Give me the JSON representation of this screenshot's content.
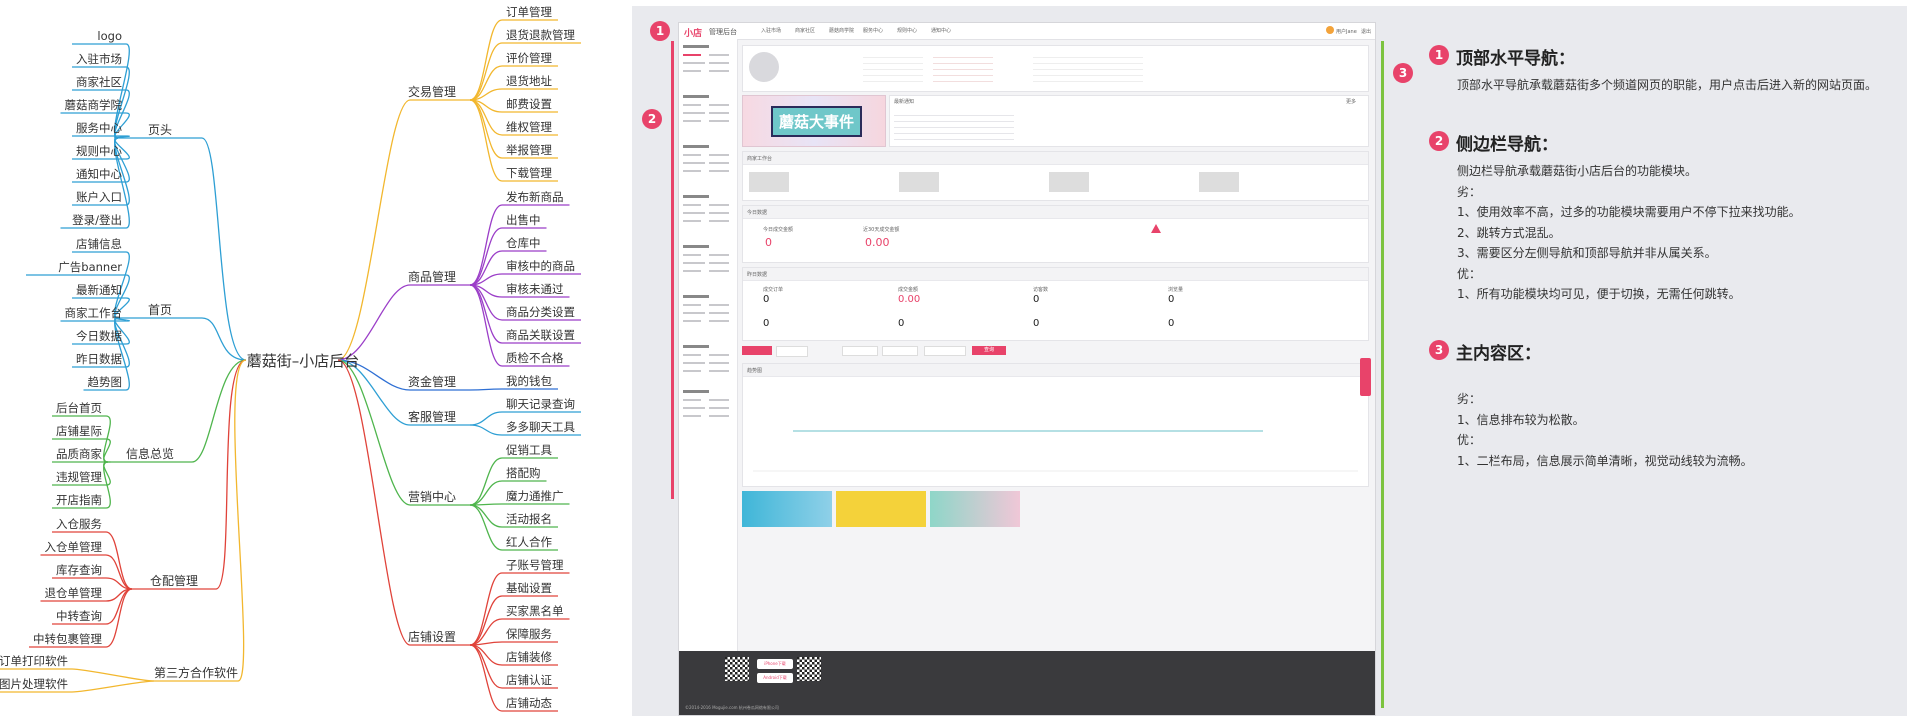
{
  "mindmap": {
    "root": "蘑菇街–小店后台",
    "left_branches": [
      {
        "label": "页头",
        "color": "#2e9fd4",
        "children": [
          "logo",
          "入驻市场",
          "商家社区",
          "蘑菇商学院",
          "服务中心",
          "规则中心",
          "通知中心",
          "账户入口",
          "登录/登出"
        ]
      },
      {
        "label": "首页",
        "color": "#2e9fd4",
        "children": [
          "店铺信息",
          "广告banner",
          "最新通知",
          "商家工作台",
          "今日数据",
          "昨日数据",
          "趋势图"
        ]
      },
      {
        "label": "信息总览",
        "color": "#4fb54d",
        "children": [
          "后台首页",
          "店铺星际",
          "品质商家",
          "违规管理",
          "开店指南"
        ]
      },
      {
        "label": "仓配管理",
        "color": "#e0433a",
        "children": [
          "入仓服务",
          "入仓单管理",
          "库存查询",
          "退仓单管理",
          "中转查询",
          "中转包裹管理"
        ]
      },
      {
        "label": "第三方合作软件",
        "color": "#f2b72e",
        "children": [
          "订单打印软件",
          "图片处理软件"
        ]
      }
    ],
    "right_branches": [
      {
        "label": "交易管理",
        "color": "#f2b72e",
        "children": [
          "订单管理",
          "退货退款管理",
          "评价管理",
          "退货地址",
          "邮费设置",
          "维权管理",
          "举报管理",
          "下载管理"
        ]
      },
      {
        "label": "商品管理",
        "color": "#9b3ec8",
        "children": [
          "发布新商品",
          "出售中",
          "仓库中",
          "审核中的商品",
          "审核未通过",
          "商品分类设置",
          "商品关联设置",
          "质检不合格"
        ]
      },
      {
        "label": "资金管理",
        "color": "#2e6fd4",
        "children": [
          "我的钱包"
        ]
      },
      {
        "label": "客服管理",
        "color": "#2e9fd4",
        "children": [
          "聊天记录查询",
          "多多聊天工具"
        ]
      },
      {
        "label": "营销中心",
        "color": "#4fb54d",
        "children": [
          "促销工具",
          "搭配购",
          "魔力通推广",
          "活动报名",
          "红人合作"
        ]
      },
      {
        "label": "店铺设置",
        "color": "#e0433a",
        "children": [
          "子账号管理",
          "基础设置",
          "买家黑名单",
          "保障服务",
          "店铺装修",
          "店铺认证",
          "店铺动态"
        ]
      }
    ]
  },
  "screenshot": {
    "logo": "小店",
    "app_title": "管理后台",
    "top_nav": [
      "入驻市场",
      "商家社区",
      "蘑菇商学院",
      "服务中心",
      "规则中心",
      "通知中心"
    ],
    "user_label": "用户Jane",
    "logout": "退出",
    "banner_text": "蘑菇大事件",
    "notice_title": "最新通知",
    "notice_more": "更多",
    "workbench_title": "商家工作台",
    "today_title": "今日数据",
    "today_items": [
      "今日成交金额",
      "近30天成交金额"
    ],
    "today_values": [
      "0",
      "0.00"
    ],
    "yesterday_title": "昨日数据",
    "yesterday_labels": [
      "成交订单",
      "成交金额",
      "访客数",
      "浏览量"
    ],
    "yesterday_values": [
      "0",
      "0.00",
      "0",
      "0"
    ],
    "yesterday_values_row2": [
      "0",
      "0",
      "0",
      "0"
    ],
    "trend_title": "趋势图",
    "search_button": "查询",
    "footer_ios": "iPhone下载",
    "footer_android": "Android下载",
    "footer_copyright": "©2014-2016 Mogujie.com 杭州卷瓜网络有限公司"
  },
  "annotations": [
    {
      "num": "1",
      "title": "顶部水平导航：",
      "lines": [
        "顶部水平导航承载蘑菇街多个频道网页的职能，用户点击后进入新的网站页面。"
      ]
    },
    {
      "num": "2",
      "title": "侧边栏导航：",
      "lines": [
        "侧边栏导航承载蘑菇街小店后台的功能模块。",
        "劣：",
        "1、使用效率不高，过多的功能模块需要用户不停下拉来找功能。",
        "2、跳转方式混乱。",
        "3、需要区分左侧导航和顶部导航并非从属关系。",
        "优：",
        "1、所有功能模块均可见，便于切换，无需任何跳转。"
      ]
    },
    {
      "num": "3",
      "title": "主内容区：",
      "lines": [
        "劣：",
        "1、信息排布较为松散。",
        "优：",
        "1、二栏布局，信息展示简单清晰，视觉动线较为流畅。"
      ]
    }
  ],
  "colors": {
    "badge": "#e8436a",
    "green_bar": "#7cc33f",
    "left_bar": "#e8436a",
    "accent": "#e8436a"
  }
}
